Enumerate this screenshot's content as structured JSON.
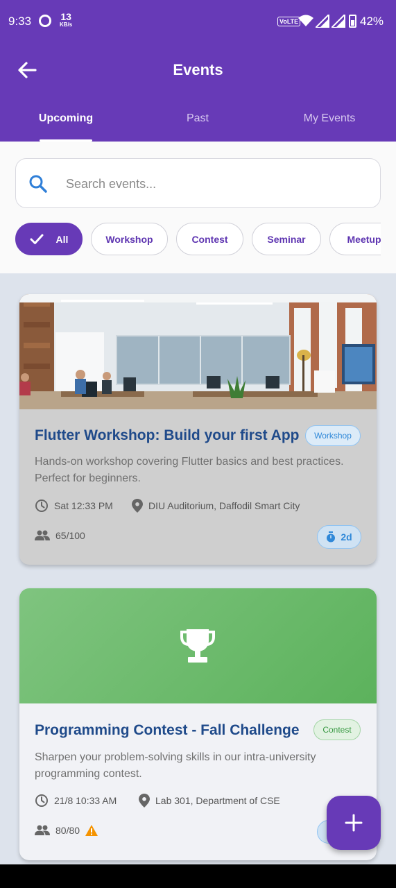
{
  "status_bar": {
    "time": "9:33",
    "speed_value": "13",
    "speed_unit": "KB/s",
    "network_label": "VoLTE",
    "battery_percent": "42%"
  },
  "app_bar": {
    "title": "Events",
    "back_icon": "arrow-left-icon"
  },
  "tabs": [
    {
      "label": "Upcoming",
      "active": true
    },
    {
      "label": "Past",
      "active": false
    },
    {
      "label": "My Events",
      "active": false
    }
  ],
  "search": {
    "placeholder": "Search events...",
    "icon": "search-icon"
  },
  "filters": [
    {
      "label": "All",
      "selected": true
    },
    {
      "label": "Workshop",
      "selected": false
    },
    {
      "label": "Contest",
      "selected": false
    },
    {
      "label": "Seminar",
      "selected": false
    },
    {
      "label": "Meetup",
      "selected": false
    }
  ],
  "events": [
    {
      "title": "Flutter Workshop: Build your first App",
      "category": "Workshop",
      "description": "Hands-on workshop covering Flutter basics and best practices. Perfect for beginners.",
      "datetime": "Sat 12:33 PM",
      "location": "DIU Auditorium, Daffodil Smart City",
      "attendees": "65/100",
      "countdown": "2d",
      "image": "office-photo"
    },
    {
      "title": "Programming Contest - Fall Challenge",
      "category": "Contest",
      "description": "Sharpen your problem-solving skills in our intra-university programming contest.",
      "datetime": "21/8 10:33 AM",
      "location": "Lab 301, Department of CSE",
      "attendees": "80/80",
      "full_warning_icon": "warning-icon",
      "image": "trophy-icon"
    }
  ],
  "fab": {
    "icon": "plus-icon"
  },
  "colors": {
    "primary": "#673ab7",
    "title_blue": "#1f4a8a",
    "workshop_badge": "#2f88d8",
    "contest_badge": "#3a9a44",
    "warning": "#f59300",
    "contest_hero": "#66b866"
  }
}
